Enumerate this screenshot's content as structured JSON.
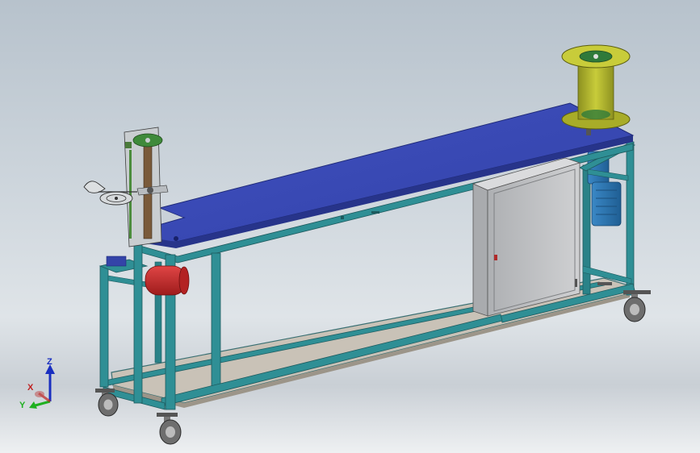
{
  "triad": {
    "x_label": "X",
    "y_label": "Y",
    "z_label": "Z"
  },
  "colors": {
    "frame": "#2f8f95",
    "table_top": "#3b49b3",
    "base_plate": "#c8c1b6",
    "cabinet": "#c3c4c6",
    "spool": "#b4b82a",
    "tank": "#c62828",
    "motor": "#2f78b5",
    "background": "#c9d1d8"
  }
}
